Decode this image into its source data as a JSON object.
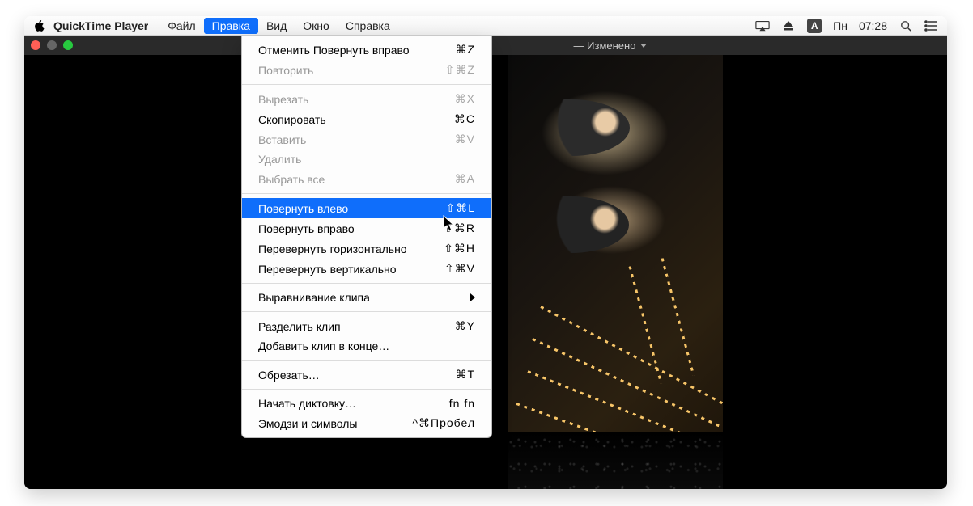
{
  "menubar": {
    "app_name": "QuickTime Player",
    "items": [
      "Файл",
      "Правка",
      "Вид",
      "Окно",
      "Справка"
    ],
    "active_index": 1,
    "status": {
      "input_letter": "A",
      "day": "Пн",
      "time": "07:28"
    }
  },
  "window": {
    "title_suffix": "— Изменено"
  },
  "dropdown": {
    "groups": [
      [
        {
          "label": "Отменить Повернуть вправо",
          "shortcut": "⌘Z",
          "disabled": false
        },
        {
          "label": "Повторить",
          "shortcut": "⇧⌘Z",
          "disabled": true
        }
      ],
      [
        {
          "label": "Вырезать",
          "shortcut": "⌘X",
          "disabled": true
        },
        {
          "label": "Скопировать",
          "shortcut": "⌘C",
          "disabled": false
        },
        {
          "label": "Вставить",
          "shortcut": "⌘V",
          "disabled": true
        },
        {
          "label": "Удалить",
          "shortcut": "",
          "disabled": true
        },
        {
          "label": "Выбрать все",
          "shortcut": "⌘A",
          "disabled": true
        }
      ],
      [
        {
          "label": "Повернуть влево",
          "shortcut": "⇧⌘L",
          "disabled": false,
          "highlighted": true
        },
        {
          "label": "Повернуть вправо",
          "shortcut": "⇧⌘R",
          "disabled": false
        },
        {
          "label": "Перевернуть горизонтально",
          "shortcut": "⇧⌘H",
          "disabled": false
        },
        {
          "label": "Перевернуть вертикально",
          "shortcut": "⇧⌘V",
          "disabled": false
        }
      ],
      [
        {
          "label": "Выравнивание клипа",
          "shortcut": "",
          "disabled": false,
          "submenu": true
        }
      ],
      [
        {
          "label": "Разделить клип",
          "shortcut": "⌘Y",
          "disabled": false
        },
        {
          "label": "Добавить клип в конце…",
          "shortcut": "",
          "disabled": false
        }
      ],
      [
        {
          "label": "Обрезать…",
          "shortcut": "⌘T",
          "disabled": false
        }
      ],
      [
        {
          "label": "Начать диктовку…",
          "shortcut": "fn fn",
          "disabled": false
        },
        {
          "label": "Эмодзи и символы",
          "shortcut": "^⌘Пробел",
          "disabled": false
        }
      ]
    ]
  }
}
